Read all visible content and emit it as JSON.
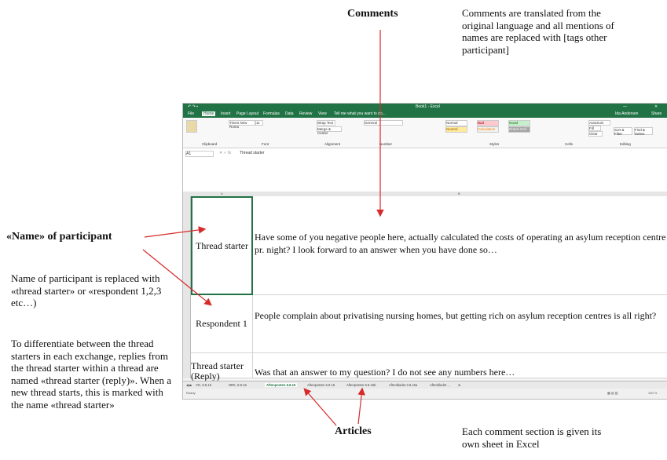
{
  "annotations": {
    "comments_title": "Comments",
    "comments_note": "Comments are translated from the original  language and all mentions of names are replaced with [tags other participant]",
    "name_title": "«Name» of participant",
    "name_note": "Name of participant is replaced with «thread starter» or «respondent 1,2,3 etc…)",
    "differentiate_note": "To differentiate  between the thread starters in each exchange, replies from the thread starter within a thread are named «thread starter (reply)». When a new thread starts, this is marked with the name «thread starter»",
    "articles_title": "Articles",
    "sheet_note": "Each comment section is given its own sheet in Excel"
  },
  "excel": {
    "window_title": "Book1 - Excel",
    "user": "Ida Andersen",
    "share": "Share",
    "menu": [
      "File",
      "Home",
      "Insert",
      "Page Layout",
      "Formulas",
      "Data",
      "Review",
      "View"
    ],
    "tell_me": "Tell me what you want to do...",
    "font_name": "Times New Roma",
    "font_size": "11",
    "number_format": "General",
    "style_normal": "Normal",
    "style_bad": "Bad",
    "style_good": "Good",
    "style_neutral": "Neutral",
    "style_calculation": "Calculation",
    "style_check": "Check Cell",
    "wrap_text": "Wrap Text",
    "merge_center": "Merge & Center",
    "autosum": "AutoSum",
    "fill": "Fill",
    "clear": "Clear",
    "sort_filter": "Sort & Filter",
    "find_select": "Find & Select",
    "group_labels": [
      "Clipboard",
      "Font",
      "Alignment",
      "Number",
      "Styles",
      "Cells",
      "Editing"
    ],
    "name_box": "A1",
    "formula_value": "Thread starter",
    "col_a": "A",
    "col_b": "B",
    "rows": [
      {
        "speaker": "Thread starter",
        "comment": "Have some of you negative people here, actually calculated the costs of operating an asylum reception centre pr. night? I look forward to an answer when you have done so…"
      },
      {
        "speaker": "Respondent 1",
        "comment": "People complain about privatising nursing homes, but getting rich on asylum reception centres is all right?"
      },
      {
        "speaker": "Thread starter (Reply)",
        "comment": "Was that an answer to my question? I do not see any numbers here…"
      }
    ],
    "tabs": [
      "VG, 8.8.15",
      "NRK, 8.8.15",
      "Aftenposten 5.8.15",
      "Aftenposten 6.8.15",
      "Aftenposten 6.8.15b",
      "Aftenbladet 3.8.15a",
      "Aftenbladet ..."
    ],
    "active_tab_index": 2,
    "status": "Ready",
    "zoom": "100 %"
  },
  "colors": {
    "excel_green": "#217346",
    "arrow": "#d62b2b"
  }
}
